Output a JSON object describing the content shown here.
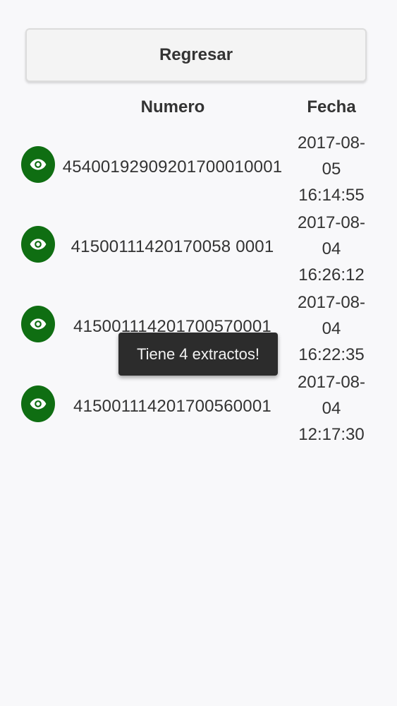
{
  "back_button": {
    "label": "Regresar"
  },
  "table": {
    "headers": {
      "numero": "Numero",
      "fecha": "Fecha"
    },
    "rows": [
      {
        "numero": "45400192909201700010001",
        "fecha_line1": "2017-08-",
        "fecha_line2": "05",
        "fecha_line3": "16:14:55",
        "icon": "eye-icon"
      },
      {
        "numero": "41500111420170058 0001",
        "fecha_line1": "2017-08-",
        "fecha_line2": "04",
        "fecha_line3": "16:26:12",
        "icon": "eye-icon"
      },
      {
        "numero": "415001114201700570001",
        "fecha_line1": "2017-08-",
        "fecha_line2": "04",
        "fecha_line3": "16:22:35",
        "icon": "eye-icon"
      },
      {
        "numero": "415001114201700560001",
        "fecha_line1": "2017-08-",
        "fecha_line2": "04",
        "fecha_line3": "12:17:30",
        "icon": "eye-icon"
      }
    ]
  },
  "toast": {
    "message": "Tiene 4 extractos!"
  },
  "colors": {
    "accent": "#0f6e12",
    "background": "#f8f8fa",
    "toast_bg": "#2c2c2c"
  }
}
